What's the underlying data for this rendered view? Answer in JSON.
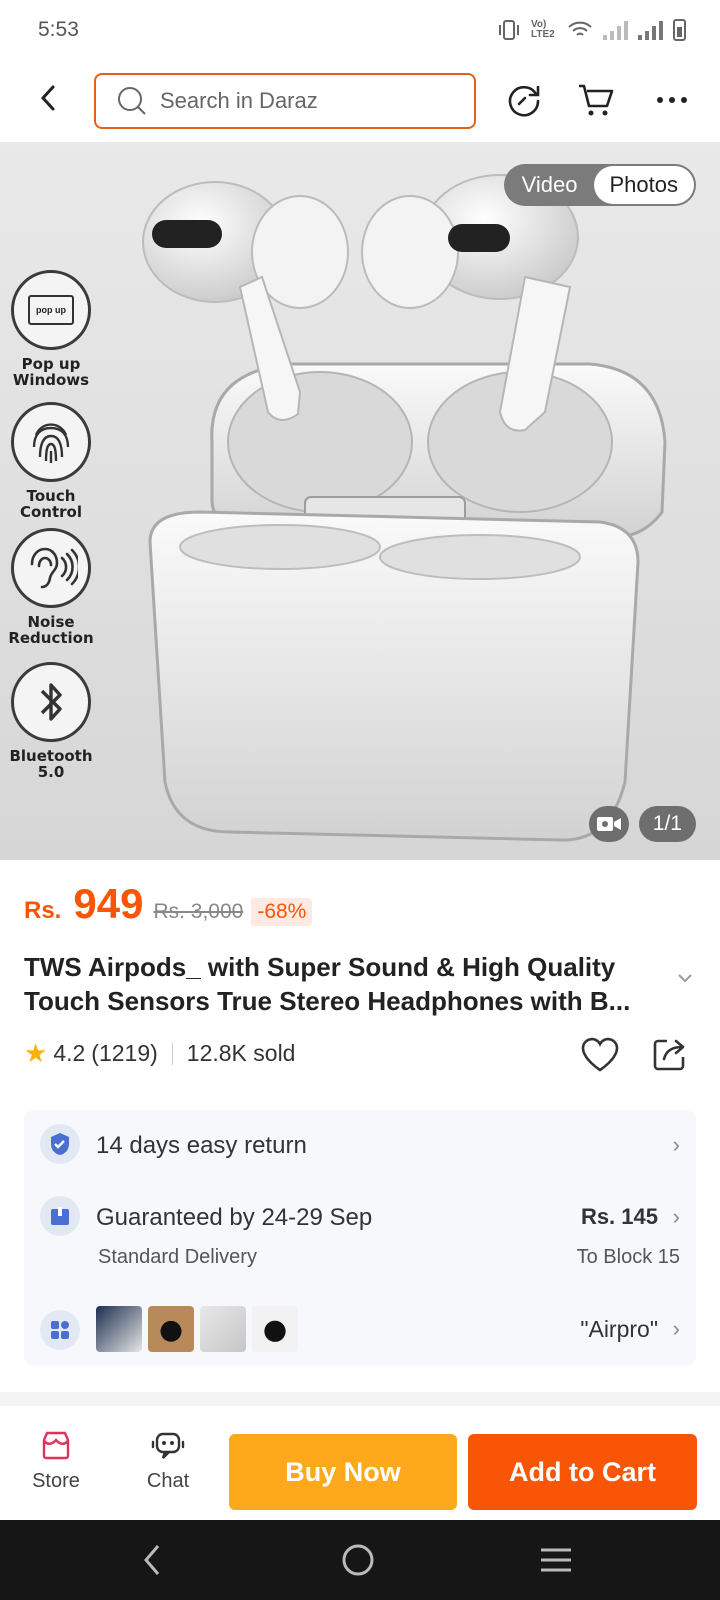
{
  "status_bar": {
    "time": "5:53",
    "lte_label": "Vo) LTE2"
  },
  "search": {
    "placeholder": "Search in Daraz"
  },
  "media": {
    "toggle_video": "Video",
    "toggle_photos": "Photos",
    "counter": "1/1",
    "features": [
      {
        "badge": "pop up",
        "label_line1": "Pop up",
        "label_line2": "Windows"
      },
      {
        "label_line1": "Touch",
        "label_line2": "Control"
      },
      {
        "label_line1": "Noise",
        "label_line2": "Reduction"
      },
      {
        "label_line1": "Bluetooth",
        "label_line2": "5.0"
      }
    ]
  },
  "product": {
    "currency": "Rs.",
    "price": "949",
    "original_price": "Rs. 3,000",
    "discount": "-68%",
    "title_line1": "TWS Airpods_ with Super Sound & High Quality",
    "title_line2": "Touch Sensors True Stereo Headphones with B...",
    "rating": "4.2",
    "reviews": "(1219)",
    "sold": "12.8K sold"
  },
  "info": {
    "return_text": "14 days easy return",
    "delivery_text": "Guaranteed by 24-29 Sep",
    "delivery_sub": "Standard Delivery",
    "delivery_fee": "Rs. 145",
    "delivery_dest": "To Block 15",
    "related_query": "\"Airpro\""
  },
  "bottom": {
    "store_label": "Store",
    "chat_label": "Chat",
    "buy_now": "Buy Now",
    "add_to_cart": "Add to Cart"
  },
  "colors": {
    "accent": "#f85606",
    "buy": "#fea81c",
    "search_border": "#e2601b"
  }
}
